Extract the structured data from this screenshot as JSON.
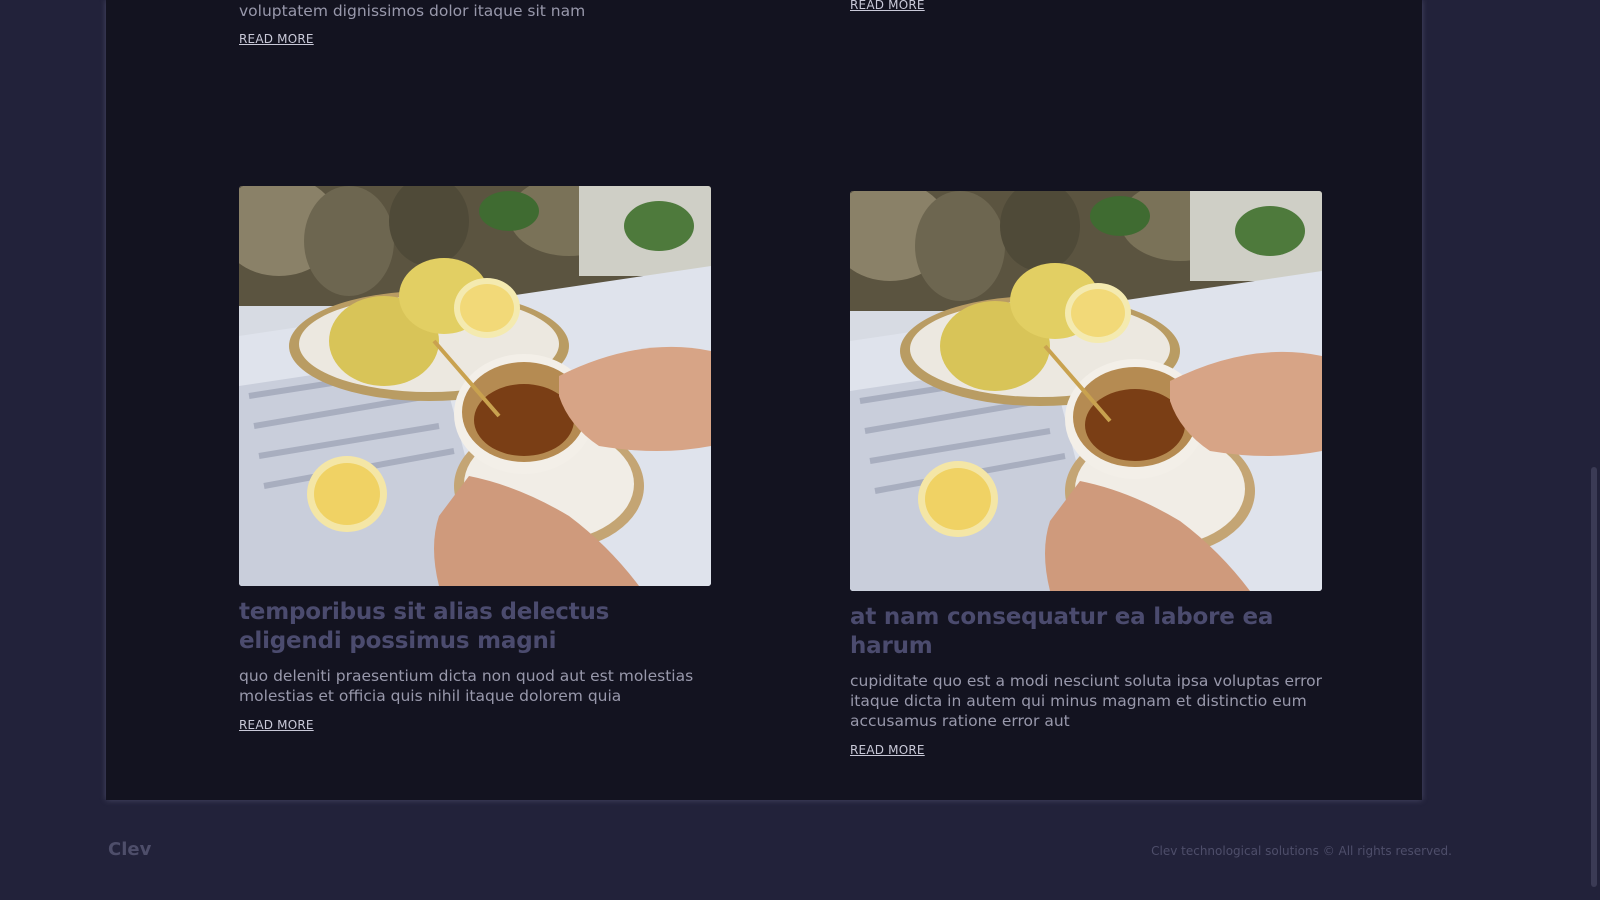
{
  "posts_top": {
    "left_excerpt_tail": "voluptatem dignissimos dolor itaque sit nam",
    "left_read_more": "READ MORE",
    "right_read_more": "READ MORE"
  },
  "posts": [
    {
      "image": "tea-with-lemons-photo",
      "title": "temporibus sit alias delectus eligendi possimus magni",
      "excerpt": "quo deleniti praesentium dicta non quod aut est molestias molestias et officia quis nihil itaque dolorem quia",
      "read_more": "READ MORE"
    },
    {
      "image": "tea-with-lemons-photo",
      "title": "at nam consequatur ea labore ea harum",
      "excerpt": "cupiditate quo est a modi nesciunt soluta ipsa voluptas error itaque dicta in autem qui minus magnam et distinctio eum accusamus ratione error aut",
      "read_more": "READ MORE"
    }
  ],
  "footer": {
    "brand": "Clev",
    "copyright": "Clev technological solutions © All rights reserved."
  },
  "colors": {
    "page_background": "#22223a",
    "panel_background": "#131320",
    "title": "#4b4b6e",
    "body_text": "#9898ab",
    "link": "#c9c9d8"
  }
}
